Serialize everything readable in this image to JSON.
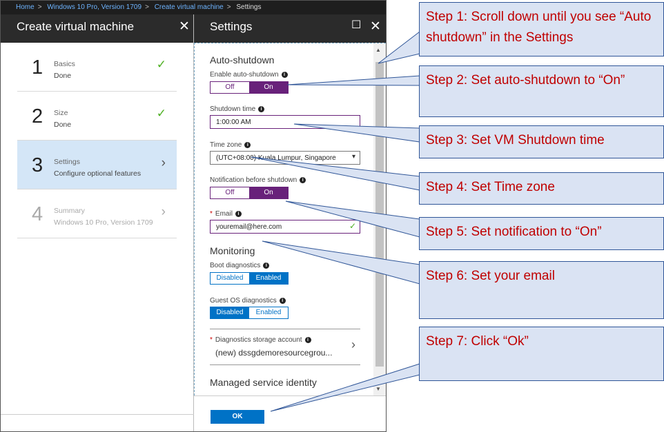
{
  "breadcrumb": {
    "items": [
      "Home",
      "Windows 10 Pro, Version 1709",
      "Create virtual machine"
    ],
    "current": "Settings"
  },
  "left_blade": {
    "title": "Create virtual machine",
    "close_icon": "close-icon",
    "steps": [
      {
        "num": "1",
        "title": "Basics",
        "subtitle": "Done",
        "status": "check-icon"
      },
      {
        "num": "2",
        "title": "Size",
        "subtitle": "Done",
        "status": "check-icon"
      },
      {
        "num": "3",
        "title": "Settings",
        "subtitle": "Configure optional features",
        "status": "chevron-right-icon"
      },
      {
        "num": "4",
        "title": "Summary",
        "subtitle": "Windows 10 Pro, Version 1709",
        "status": "chevron-right-icon"
      }
    ]
  },
  "right_blade": {
    "title": "Settings",
    "auto_shutdown": {
      "heading": "Auto-shutdown",
      "enable_label": "Enable auto-shutdown",
      "off": "Off",
      "on": "On",
      "shutdown_time_label": "Shutdown time",
      "shutdown_time_value": "1:00:00 AM",
      "timezone_label": "Time zone",
      "timezone_value": "(UTC+08:00) Kuala Lumpur, Singapore",
      "notification_label": "Notification before shutdown",
      "email_label": "Email",
      "email_value": "youremail@here.com"
    },
    "monitoring": {
      "heading": "Monitoring",
      "boot_label": "Boot diagnostics",
      "guest_label": "Guest OS diagnostics",
      "disabled": "Disabled",
      "enabled": "Enabled",
      "storage_label": "Diagnostics storage account",
      "storage_value": "(new) dssgdemoresourcegrou..."
    },
    "msi_heading": "Managed service identity",
    "ok_label": "OK"
  },
  "callouts": [
    "Step 1: Scroll down until you see “Auto shutdown” in the Settings",
    "Step 2: Set auto-shutdown to “On”",
    "Step 3: Set VM Shutdown time",
    "Step 4: Set Time zone",
    "Step 5: Set notification to “On”",
    "Step 6: Set your email",
    "Step 7: Click “Ok”"
  ],
  "colors": {
    "toggle_accent": "#68217a",
    "enabled_accent": "#0072c6",
    "callout_fill": "#dae3f3",
    "callout_text": "#c00000"
  }
}
